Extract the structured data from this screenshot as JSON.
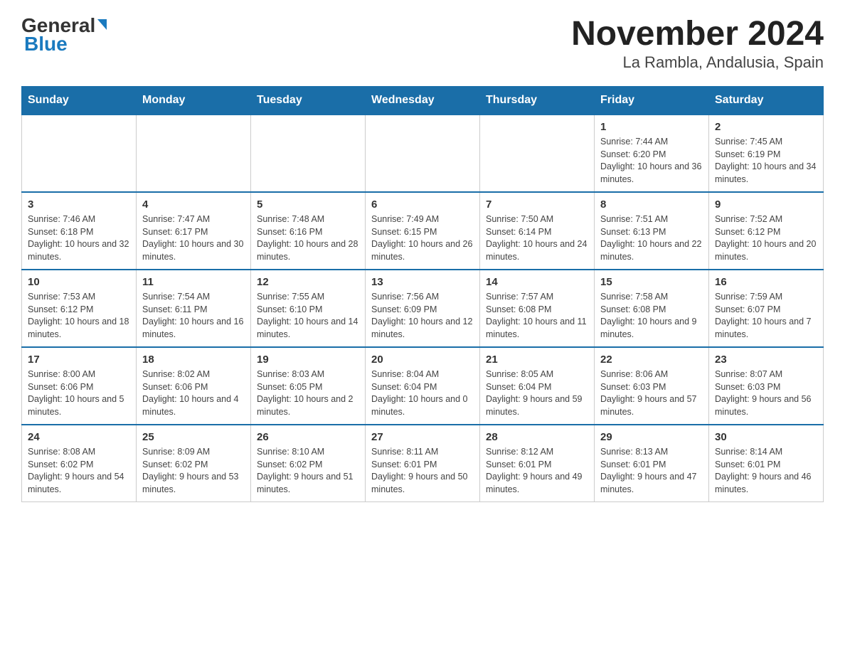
{
  "logo": {
    "text_general": "General",
    "text_blue": "Blue"
  },
  "title": "November 2024",
  "subtitle": "La Rambla, Andalusia, Spain",
  "weekdays": [
    "Sunday",
    "Monday",
    "Tuesday",
    "Wednesday",
    "Thursday",
    "Friday",
    "Saturday"
  ],
  "weeks": [
    [
      {
        "day": "",
        "info": ""
      },
      {
        "day": "",
        "info": ""
      },
      {
        "day": "",
        "info": ""
      },
      {
        "day": "",
        "info": ""
      },
      {
        "day": "",
        "info": ""
      },
      {
        "day": "1",
        "info": "Sunrise: 7:44 AM\nSunset: 6:20 PM\nDaylight: 10 hours and 36 minutes."
      },
      {
        "day": "2",
        "info": "Sunrise: 7:45 AM\nSunset: 6:19 PM\nDaylight: 10 hours and 34 minutes."
      }
    ],
    [
      {
        "day": "3",
        "info": "Sunrise: 7:46 AM\nSunset: 6:18 PM\nDaylight: 10 hours and 32 minutes."
      },
      {
        "day": "4",
        "info": "Sunrise: 7:47 AM\nSunset: 6:17 PM\nDaylight: 10 hours and 30 minutes."
      },
      {
        "day": "5",
        "info": "Sunrise: 7:48 AM\nSunset: 6:16 PM\nDaylight: 10 hours and 28 minutes."
      },
      {
        "day": "6",
        "info": "Sunrise: 7:49 AM\nSunset: 6:15 PM\nDaylight: 10 hours and 26 minutes."
      },
      {
        "day": "7",
        "info": "Sunrise: 7:50 AM\nSunset: 6:14 PM\nDaylight: 10 hours and 24 minutes."
      },
      {
        "day": "8",
        "info": "Sunrise: 7:51 AM\nSunset: 6:13 PM\nDaylight: 10 hours and 22 minutes."
      },
      {
        "day": "9",
        "info": "Sunrise: 7:52 AM\nSunset: 6:12 PM\nDaylight: 10 hours and 20 minutes."
      }
    ],
    [
      {
        "day": "10",
        "info": "Sunrise: 7:53 AM\nSunset: 6:12 PM\nDaylight: 10 hours and 18 minutes."
      },
      {
        "day": "11",
        "info": "Sunrise: 7:54 AM\nSunset: 6:11 PM\nDaylight: 10 hours and 16 minutes."
      },
      {
        "day": "12",
        "info": "Sunrise: 7:55 AM\nSunset: 6:10 PM\nDaylight: 10 hours and 14 minutes."
      },
      {
        "day": "13",
        "info": "Sunrise: 7:56 AM\nSunset: 6:09 PM\nDaylight: 10 hours and 12 minutes."
      },
      {
        "day": "14",
        "info": "Sunrise: 7:57 AM\nSunset: 6:08 PM\nDaylight: 10 hours and 11 minutes."
      },
      {
        "day": "15",
        "info": "Sunrise: 7:58 AM\nSunset: 6:08 PM\nDaylight: 10 hours and 9 minutes."
      },
      {
        "day": "16",
        "info": "Sunrise: 7:59 AM\nSunset: 6:07 PM\nDaylight: 10 hours and 7 minutes."
      }
    ],
    [
      {
        "day": "17",
        "info": "Sunrise: 8:00 AM\nSunset: 6:06 PM\nDaylight: 10 hours and 5 minutes."
      },
      {
        "day": "18",
        "info": "Sunrise: 8:02 AM\nSunset: 6:06 PM\nDaylight: 10 hours and 4 minutes."
      },
      {
        "day": "19",
        "info": "Sunrise: 8:03 AM\nSunset: 6:05 PM\nDaylight: 10 hours and 2 minutes."
      },
      {
        "day": "20",
        "info": "Sunrise: 8:04 AM\nSunset: 6:04 PM\nDaylight: 10 hours and 0 minutes."
      },
      {
        "day": "21",
        "info": "Sunrise: 8:05 AM\nSunset: 6:04 PM\nDaylight: 9 hours and 59 minutes."
      },
      {
        "day": "22",
        "info": "Sunrise: 8:06 AM\nSunset: 6:03 PM\nDaylight: 9 hours and 57 minutes."
      },
      {
        "day": "23",
        "info": "Sunrise: 8:07 AM\nSunset: 6:03 PM\nDaylight: 9 hours and 56 minutes."
      }
    ],
    [
      {
        "day": "24",
        "info": "Sunrise: 8:08 AM\nSunset: 6:02 PM\nDaylight: 9 hours and 54 minutes."
      },
      {
        "day": "25",
        "info": "Sunrise: 8:09 AM\nSunset: 6:02 PM\nDaylight: 9 hours and 53 minutes."
      },
      {
        "day": "26",
        "info": "Sunrise: 8:10 AM\nSunset: 6:02 PM\nDaylight: 9 hours and 51 minutes."
      },
      {
        "day": "27",
        "info": "Sunrise: 8:11 AM\nSunset: 6:01 PM\nDaylight: 9 hours and 50 minutes."
      },
      {
        "day": "28",
        "info": "Sunrise: 8:12 AM\nSunset: 6:01 PM\nDaylight: 9 hours and 49 minutes."
      },
      {
        "day": "29",
        "info": "Sunrise: 8:13 AM\nSunset: 6:01 PM\nDaylight: 9 hours and 47 minutes."
      },
      {
        "day": "30",
        "info": "Sunrise: 8:14 AM\nSunset: 6:01 PM\nDaylight: 9 hours and 46 minutes."
      }
    ]
  ]
}
